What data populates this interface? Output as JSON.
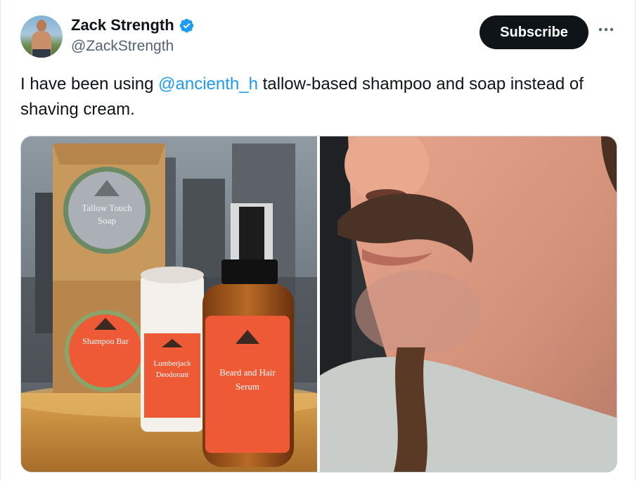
{
  "author": {
    "display_name": "Zack Strength",
    "handle": "@ZackStrength",
    "verified": true,
    "avatar_icon": "avatar-photo"
  },
  "actions": {
    "subscribe_label": "Subscribe",
    "more_icon": "more-horizontal-icon"
  },
  "tweet": {
    "text_before": "I have been using ",
    "mention": "@ancienth_h",
    "text_after": " tallow-based shampoo and soap instead of shaving cream."
  },
  "product_labels": {
    "soap_line1": "Tallow Touch",
    "soap_line2": "Soap",
    "shampoo": "Shampoo Bar",
    "deodorant_line1": "Lumberjack",
    "deodorant_line2": "Deodorant",
    "serum_line1": "Beard and Hair",
    "serum_line2": "Serum"
  },
  "colors": {
    "accent_blue": "#1d9bf0",
    "button_black": "#0f1419",
    "secondary_text": "#536471",
    "label_orange": "#ee5a36"
  }
}
